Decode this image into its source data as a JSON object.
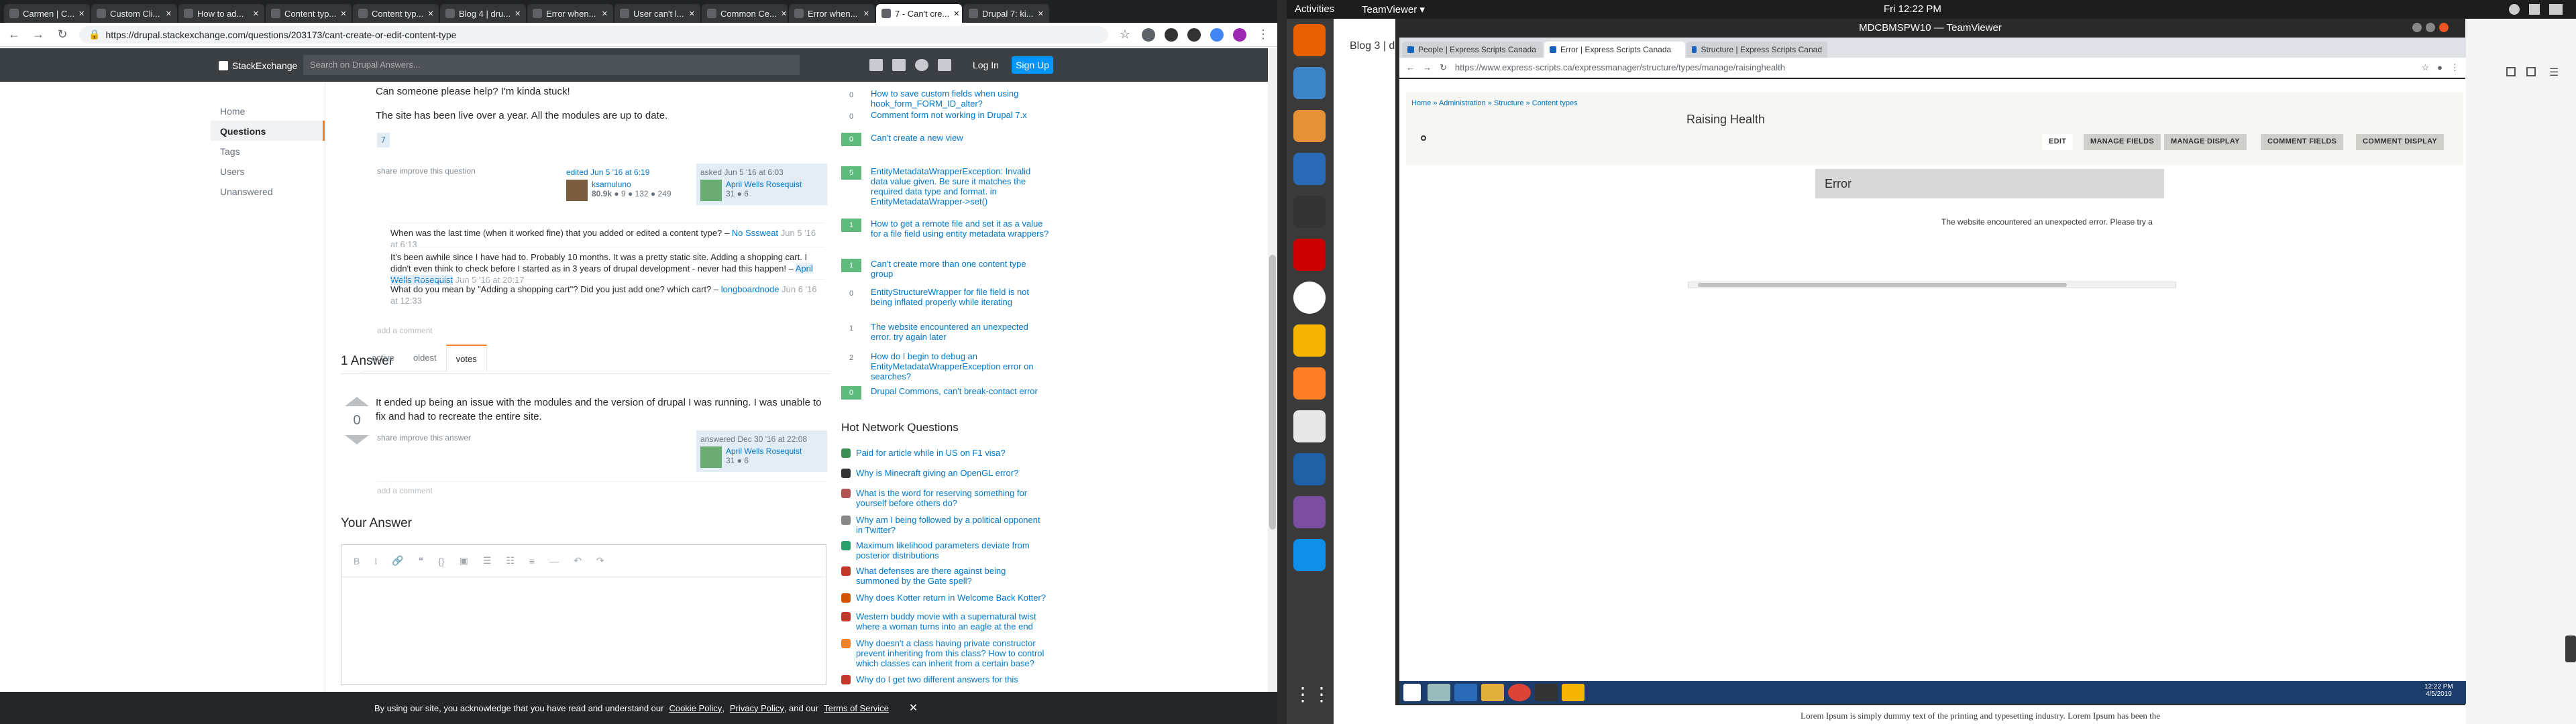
{
  "left_browser": {
    "tabs": [
      {
        "label": "Carmen | C...",
        "active": false
      },
      {
        "label": "Custom Cli...",
        "active": false
      },
      {
        "label": "How to ad...",
        "active": false
      },
      {
        "label": "Content typ...",
        "active": false
      },
      {
        "label": "Content typ...",
        "active": false
      },
      {
        "label": "Blog 4 | dru...",
        "active": false
      },
      {
        "label": "Error when...",
        "active": false
      },
      {
        "label": "User can't l...",
        "active": false
      },
      {
        "label": "Common Ce...",
        "active": false
      },
      {
        "label": "Error when...",
        "active": false
      },
      {
        "label": "7 - Can't cre...",
        "active": true
      },
      {
        "label": "Drupal 7: ki...",
        "active": false
      }
    ],
    "url": "https://drupal.stackexchange.com/questions/203173/cant-create-or-edit-content-type"
  },
  "site": {
    "logo": "StackExchange",
    "search_placeholder": "Search on Drupal Answers...",
    "login": "Log In",
    "signup": "Sign Up",
    "nav": [
      "Home",
      "Questions",
      "Tags",
      "Users",
      "Unanswered"
    ],
    "nav_active": "Questions"
  },
  "question": {
    "text1": "Can someone please help? I'm kinda stuck!",
    "text2": "The site has been live over a year. All the modules are up to date.",
    "tag": "7",
    "share": "share  improve this question",
    "edited": "edited Jun 5 '16 at 6:19",
    "editor_name": "ksarnuluno",
    "editor_rep": "80.9k",
    "editor_badges": "● 9  ● 132  ● 249",
    "asked": "asked Jun 5 '16 at 6:03",
    "asker_name": "April Wells Rosequist",
    "asker_rep": "31  ● 6",
    "comments": [
      {
        "text": "When was the last time (when it worked fine) that you added or edited a content type? –",
        "user": "No Sssweat",
        "time": "Jun 5 '16 at 6:13"
      },
      {
        "text": "It's been awhile since I have had to. Probably 10 months. It was a pretty static site. Adding a shopping cart. I didn't even think to check before I started as in 3 years of drupal development - never had this happen! –",
        "user": "April Wells Rosequist",
        "time": "Jun 5 '16 at 20:17"
      },
      {
        "text": "What do you mean by \"Adding a shopping cart\"? Did you just add one? which cart? –",
        "user": "longboardnode",
        "time": "Jun 6 '16 at 12:33"
      }
    ],
    "add_comment": "add a comment"
  },
  "answers": {
    "heading": "1 Answer",
    "tabs": [
      "active",
      "oldest",
      "votes"
    ],
    "active_tab": "votes",
    "votes": "0",
    "text": "It ended up being an issue with the modules and the version of drupal I was running. I was unable to fix and had to recreate the entire site.",
    "share": "share  improve this answer",
    "answered": "answered Dec 30 '16 at 22:08",
    "answerer_name": "April Wells Rosequist",
    "answerer_rep": "31  ● 6",
    "add_comment": "add a comment"
  },
  "your_answer": {
    "heading": "Your Answer",
    "toolbar": [
      "B",
      "I",
      "🔗",
      "❝",
      "{}",
      "▣",
      "☰",
      "☷",
      "≡",
      "—",
      "↶",
      "↷"
    ]
  },
  "related": [
    {
      "count": "0",
      "green": false,
      "text": "How to save custom fields when using hook_form_FORM_ID_alter?"
    },
    {
      "count": "0",
      "green": false,
      "text": "Comment form not working in Drupal 7.x"
    },
    {
      "count": "0",
      "green": true,
      "text": "Can't create a new view"
    },
    {
      "count": "5",
      "green": true,
      "text": "EntityMetadataWrapperException: Invalid data value given. Be sure it matches the required data type and format. in EntityMetadataWrapper->set()"
    },
    {
      "count": "1",
      "green": true,
      "text": "How to get a remote file and set it as a value for a file field using entity metadata wrappers?"
    },
    {
      "count": "1",
      "green": true,
      "text": "Can't create more than one content type group"
    },
    {
      "count": "0",
      "green": false,
      "text": "EntityStructureWrapper for file field is not being inflated properly while iterating"
    },
    {
      "count": "1",
      "green": false,
      "text": "The website encountered an unexpected error. try again later"
    },
    {
      "count": "2",
      "green": false,
      "text": "How do I begin to debug an EntityMetadataWrapperException error on searches?"
    },
    {
      "count": "0",
      "green": true,
      "text": "Drupal Commons, can't break-contact error"
    }
  ],
  "hot_network": {
    "heading": "Hot Network Questions",
    "items": [
      {
        "text": "Paid for article while in US on F1 visa?",
        "color": "#3d8f58"
      },
      {
        "text": "Why is Minecraft giving an OpenGL error?",
        "color": "#333333"
      },
      {
        "text": "What is the word for reserving something for yourself before others do?",
        "color": "#b35454"
      },
      {
        "text": "Why am I being followed by a political opponent in Twitter?",
        "color": "#888888"
      },
      {
        "text": "Maximum likelihood parameters deviate from posterior distributions",
        "color": "#2a9f6e"
      },
      {
        "text": "What defenses are there against being summoned by the Gate spell?",
        "color": "#c0392b"
      },
      {
        "text": "Why does Kotter return in Welcome Back Kotter?",
        "color": "#d35400"
      },
      {
        "text": "Western buddy movie with a supernatural twist where a woman turns into an eagle at the end",
        "color": "#c0392b"
      },
      {
        "text": "Why doesn't a class having private constructor prevent inheriting from this class? How to control which classes can inherit from a certain base?",
        "color": "#f48024"
      },
      {
        "text": "Why do I get two different answers for this",
        "color": "#c0392b"
      }
    ]
  },
  "cookie": {
    "text1": "By using our site, you acknowledge that you have read and understand our",
    "link1": "Cookie Policy",
    "sep1": ",",
    "link2": "Privacy Policy",
    "sep2": ", and our",
    "link3": "Terms of Service",
    "close": "✕"
  },
  "ubuntu": {
    "activities": "Activities",
    "app": "TeamViewer ▾",
    "clock": "Fri 12:22 PM",
    "bottom_text": "Lorem Ipsum is simply dummy text of the printing and typesetting industry. Lorem Ipsum has been the",
    "blog_tab": "Blog 3 | dr"
  },
  "teamviewer": {
    "title": "MDCBMSPW10 — TeamViewer",
    "tabs": [
      {
        "label": "People | Express Scripts Canada",
        "active": false
      },
      {
        "label": "Error | Express Scripts Canada",
        "active": true
      },
      {
        "label": "Structure | Express Scripts Canad",
        "active": false
      }
    ],
    "url": "https://www.express-scripts.ca/expressmanager/structure/types/manage/raisinghealth",
    "breadcrumb": "Home » Administration » Structure » Content types",
    "page_title": "Raising Health",
    "admin_tabs": [
      "EDIT",
      "MANAGE FIELDS",
      "MANAGE DISPLAY",
      "COMMENT FIELDS",
      "COMMENT DISPLAY"
    ],
    "active_admin_tab": "EDIT",
    "error_title": "Error",
    "error_text": "The website encountered an unexpected error. Please try a",
    "win_clock": "12:22 PM",
    "win_date": "4/5/2019"
  }
}
